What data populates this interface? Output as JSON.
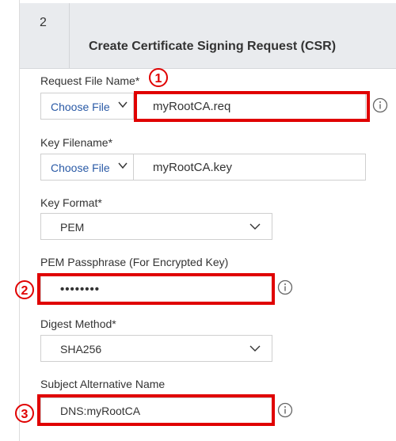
{
  "step": {
    "number": "2",
    "title": "Create Certificate Signing Request (CSR)"
  },
  "request_file": {
    "label": "Request File Name*",
    "button": "Choose File",
    "value": "myRootCA.req"
  },
  "key_file": {
    "label": "Key Filename*",
    "button": "Choose File",
    "value": "myRootCA.key"
  },
  "key_format": {
    "label": "Key Format*",
    "value": "PEM"
  },
  "pem_passphrase": {
    "label": "PEM Passphrase (For Encrypted Key)",
    "value": "••••••••"
  },
  "digest_method": {
    "label": "Digest Method*",
    "value": "SHA256"
  },
  "san": {
    "label": "Subject Alternative Name",
    "value": "DNS:myRootCA"
  },
  "markers": [
    "1",
    "2",
    "3"
  ],
  "colors": {
    "highlight": "#e00000",
    "link": "#2a5aa6",
    "header_bg": "#e9ebee"
  },
  "icons": {
    "chevron": "chevron-down-icon",
    "info": "info-icon"
  }
}
